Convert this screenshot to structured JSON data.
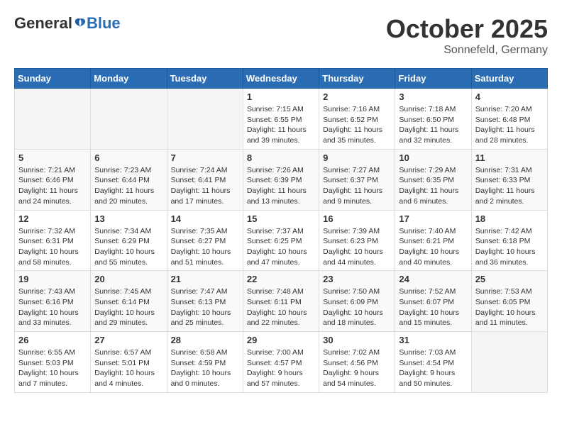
{
  "header": {
    "logo_general": "General",
    "logo_blue": "Blue",
    "month": "October 2025",
    "location": "Sonnefeld, Germany"
  },
  "days_of_week": [
    "Sunday",
    "Monday",
    "Tuesday",
    "Wednesday",
    "Thursday",
    "Friday",
    "Saturday"
  ],
  "weeks": [
    [
      {
        "day": "",
        "sunrise": "",
        "sunset": "",
        "daylight": ""
      },
      {
        "day": "",
        "sunrise": "",
        "sunset": "",
        "daylight": ""
      },
      {
        "day": "",
        "sunrise": "",
        "sunset": "",
        "daylight": ""
      },
      {
        "day": "1",
        "sunrise": "Sunrise: 7:15 AM",
        "sunset": "Sunset: 6:55 PM",
        "daylight": "Daylight: 11 hours and 39 minutes."
      },
      {
        "day": "2",
        "sunrise": "Sunrise: 7:16 AM",
        "sunset": "Sunset: 6:52 PM",
        "daylight": "Daylight: 11 hours and 35 minutes."
      },
      {
        "day": "3",
        "sunrise": "Sunrise: 7:18 AM",
        "sunset": "Sunset: 6:50 PM",
        "daylight": "Daylight: 11 hours and 32 minutes."
      },
      {
        "day": "4",
        "sunrise": "Sunrise: 7:20 AM",
        "sunset": "Sunset: 6:48 PM",
        "daylight": "Daylight: 11 hours and 28 minutes."
      }
    ],
    [
      {
        "day": "5",
        "sunrise": "Sunrise: 7:21 AM",
        "sunset": "Sunset: 6:46 PM",
        "daylight": "Daylight: 11 hours and 24 minutes."
      },
      {
        "day": "6",
        "sunrise": "Sunrise: 7:23 AM",
        "sunset": "Sunset: 6:44 PM",
        "daylight": "Daylight: 11 hours and 20 minutes."
      },
      {
        "day": "7",
        "sunrise": "Sunrise: 7:24 AM",
        "sunset": "Sunset: 6:41 PM",
        "daylight": "Daylight: 11 hours and 17 minutes."
      },
      {
        "day": "8",
        "sunrise": "Sunrise: 7:26 AM",
        "sunset": "Sunset: 6:39 PM",
        "daylight": "Daylight: 11 hours and 13 minutes."
      },
      {
        "day": "9",
        "sunrise": "Sunrise: 7:27 AM",
        "sunset": "Sunset: 6:37 PM",
        "daylight": "Daylight: 11 hours and 9 minutes."
      },
      {
        "day": "10",
        "sunrise": "Sunrise: 7:29 AM",
        "sunset": "Sunset: 6:35 PM",
        "daylight": "Daylight: 11 hours and 6 minutes."
      },
      {
        "day": "11",
        "sunrise": "Sunrise: 7:31 AM",
        "sunset": "Sunset: 6:33 PM",
        "daylight": "Daylight: 11 hours and 2 minutes."
      }
    ],
    [
      {
        "day": "12",
        "sunrise": "Sunrise: 7:32 AM",
        "sunset": "Sunset: 6:31 PM",
        "daylight": "Daylight: 10 hours and 58 minutes."
      },
      {
        "day": "13",
        "sunrise": "Sunrise: 7:34 AM",
        "sunset": "Sunset: 6:29 PM",
        "daylight": "Daylight: 10 hours and 55 minutes."
      },
      {
        "day": "14",
        "sunrise": "Sunrise: 7:35 AM",
        "sunset": "Sunset: 6:27 PM",
        "daylight": "Daylight: 10 hours and 51 minutes."
      },
      {
        "day": "15",
        "sunrise": "Sunrise: 7:37 AM",
        "sunset": "Sunset: 6:25 PM",
        "daylight": "Daylight: 10 hours and 47 minutes."
      },
      {
        "day": "16",
        "sunrise": "Sunrise: 7:39 AM",
        "sunset": "Sunset: 6:23 PM",
        "daylight": "Daylight: 10 hours and 44 minutes."
      },
      {
        "day": "17",
        "sunrise": "Sunrise: 7:40 AM",
        "sunset": "Sunset: 6:21 PM",
        "daylight": "Daylight: 10 hours and 40 minutes."
      },
      {
        "day": "18",
        "sunrise": "Sunrise: 7:42 AM",
        "sunset": "Sunset: 6:18 PM",
        "daylight": "Daylight: 10 hours and 36 minutes."
      }
    ],
    [
      {
        "day": "19",
        "sunrise": "Sunrise: 7:43 AM",
        "sunset": "Sunset: 6:16 PM",
        "daylight": "Daylight: 10 hours and 33 minutes."
      },
      {
        "day": "20",
        "sunrise": "Sunrise: 7:45 AM",
        "sunset": "Sunset: 6:14 PM",
        "daylight": "Daylight: 10 hours and 29 minutes."
      },
      {
        "day": "21",
        "sunrise": "Sunrise: 7:47 AM",
        "sunset": "Sunset: 6:13 PM",
        "daylight": "Daylight: 10 hours and 25 minutes."
      },
      {
        "day": "22",
        "sunrise": "Sunrise: 7:48 AM",
        "sunset": "Sunset: 6:11 PM",
        "daylight": "Daylight: 10 hours and 22 minutes."
      },
      {
        "day": "23",
        "sunrise": "Sunrise: 7:50 AM",
        "sunset": "Sunset: 6:09 PM",
        "daylight": "Daylight: 10 hours and 18 minutes."
      },
      {
        "day": "24",
        "sunrise": "Sunrise: 7:52 AM",
        "sunset": "Sunset: 6:07 PM",
        "daylight": "Daylight: 10 hours and 15 minutes."
      },
      {
        "day": "25",
        "sunrise": "Sunrise: 7:53 AM",
        "sunset": "Sunset: 6:05 PM",
        "daylight": "Daylight: 10 hours and 11 minutes."
      }
    ],
    [
      {
        "day": "26",
        "sunrise": "Sunrise: 6:55 AM",
        "sunset": "Sunset: 5:03 PM",
        "daylight": "Daylight: 10 hours and 7 minutes."
      },
      {
        "day": "27",
        "sunrise": "Sunrise: 6:57 AM",
        "sunset": "Sunset: 5:01 PM",
        "daylight": "Daylight: 10 hours and 4 minutes."
      },
      {
        "day": "28",
        "sunrise": "Sunrise: 6:58 AM",
        "sunset": "Sunset: 4:59 PM",
        "daylight": "Daylight: 10 hours and 0 minutes."
      },
      {
        "day": "29",
        "sunrise": "Sunrise: 7:00 AM",
        "sunset": "Sunset: 4:57 PM",
        "daylight": "Daylight: 9 hours and 57 minutes."
      },
      {
        "day": "30",
        "sunrise": "Sunrise: 7:02 AM",
        "sunset": "Sunset: 4:56 PM",
        "daylight": "Daylight: 9 hours and 54 minutes."
      },
      {
        "day": "31",
        "sunrise": "Sunrise: 7:03 AM",
        "sunset": "Sunset: 4:54 PM",
        "daylight": "Daylight: 9 hours and 50 minutes."
      },
      {
        "day": "",
        "sunrise": "",
        "sunset": "",
        "daylight": ""
      }
    ]
  ]
}
